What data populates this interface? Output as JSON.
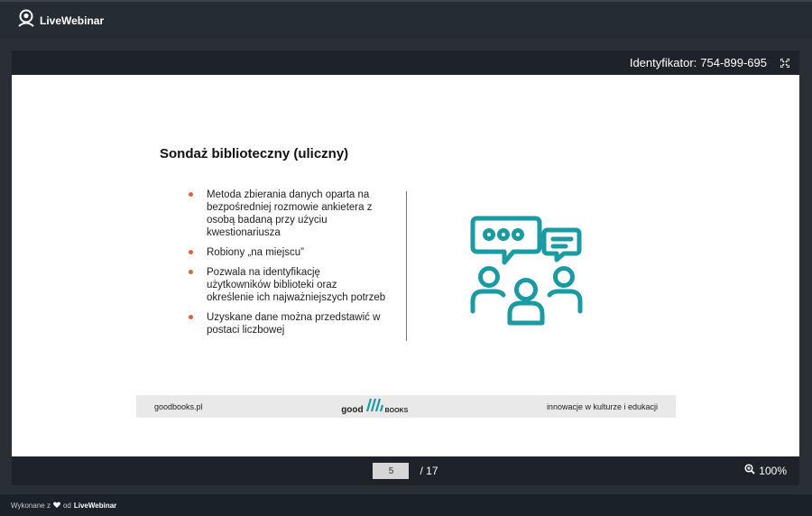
{
  "app": {
    "brand_name": "LiveWebinar"
  },
  "viewer": {
    "session_label": "Identyfikator:",
    "session_id": "754-899-695"
  },
  "slide": {
    "title": "Sondaż biblioteczny (uliczny)",
    "bullets": [
      "Metoda zbierania danych oparta na bezpośredniej rozmowie ankietera z osobą badaną przy użyciu kwestionariusza",
      "Robiony „na miejscu”",
      "Pozwala na identyfikację użytkowników biblioteki oraz określenie ich najważniejszych potrzeb",
      "Uzyskane dane można przedstawić w postaci liczbowej"
    ],
    "footer_left": "goodbooks.pl",
    "footer_logo_left": "good",
    "footer_logo_right": "books",
    "footer_right": "innowacje w kulturze i edukacji"
  },
  "pager": {
    "current_page": "5",
    "total_pages": "/ 17"
  },
  "zoom": {
    "level": "100%"
  },
  "footer": {
    "made_with": "Wykonane z",
    "by": "od",
    "brand": "LiveWebinar"
  },
  "colors": {
    "accent_teal": "#1a9aa3",
    "bullet_orange": "#d9673a"
  }
}
